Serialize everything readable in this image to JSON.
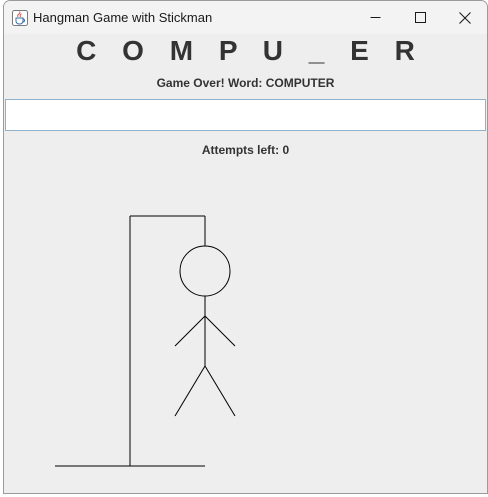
{
  "window": {
    "title": "Hangman Game with Stickman",
    "app_icon": "java-cup-icon",
    "controls": {
      "minimize": "minimize-icon",
      "maximize": "maximize-icon",
      "close": "close-icon"
    }
  },
  "game": {
    "word_display": "C O M P U _ E R",
    "status_message": "Game Over! Word: COMPUTER",
    "guess_input_value": "",
    "attempts_label": "Attempts left: 0"
  },
  "drawing": {
    "parts": [
      "base",
      "pole",
      "beam",
      "rope",
      "head",
      "body",
      "left-arm",
      "right-arm",
      "left-leg",
      "right-leg"
    ],
    "stroke_color": "#000000"
  }
}
